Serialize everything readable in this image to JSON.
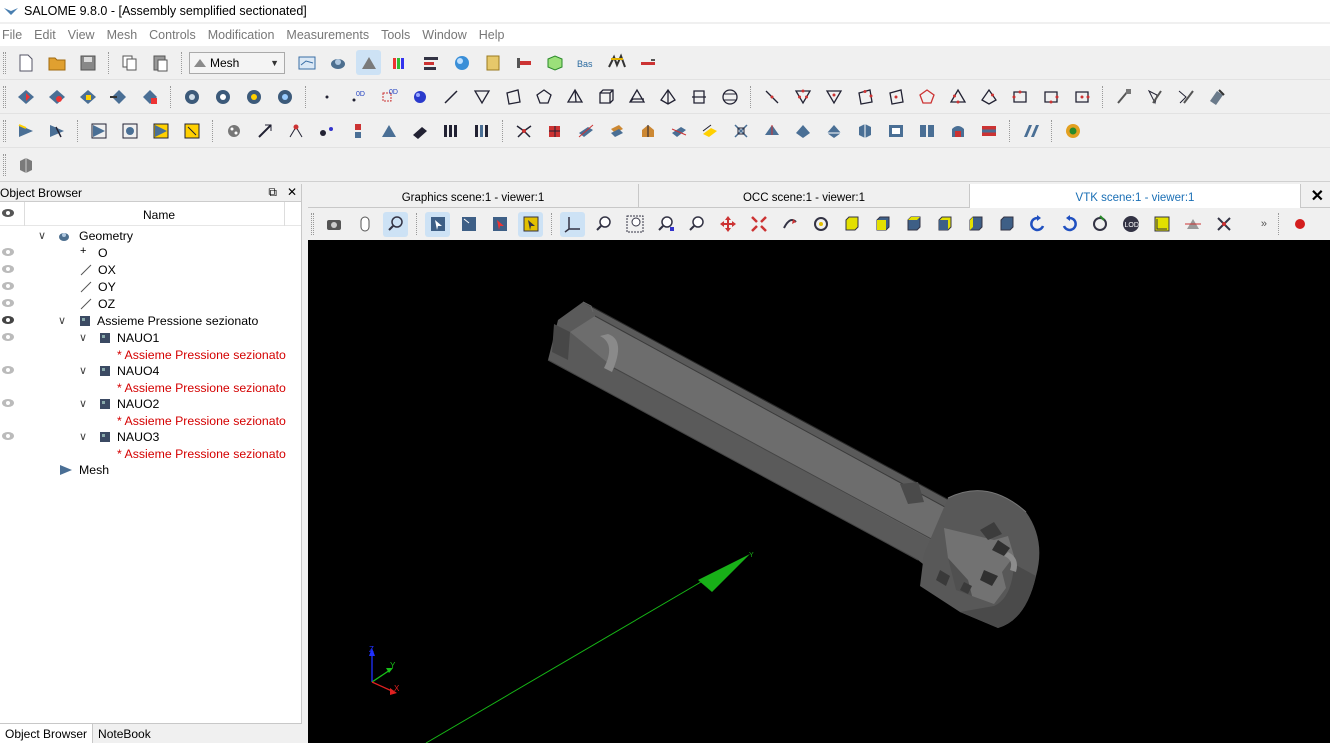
{
  "window": {
    "title": "SALOME  9.8.0 - [Assembly semplified sectionated]"
  },
  "menu": [
    "File",
    "Edit",
    "View",
    "Mesh",
    "Controls",
    "Modification",
    "Measurements",
    "Tools",
    "Window",
    "Help"
  ],
  "toolbar": {
    "module_selector": "Mesh"
  },
  "object_browser": {
    "title": "Object Browser",
    "column_name": "Name",
    "tabs": [
      "Object Browser",
      "NoteBook"
    ],
    "tree": [
      {
        "label": "Geometry",
        "level": 0
      },
      {
        "label": "O",
        "level": 1
      },
      {
        "label": "OX",
        "level": 1
      },
      {
        "label": "OY",
        "level": 1
      },
      {
        "label": "OZ",
        "level": 1
      },
      {
        "label": "Assieme Pressione sezionato",
        "level": 1
      },
      {
        "label": "NAUO1",
        "level": 2
      },
      {
        "label": "* Assieme Pressione sezionato",
        "level": 3
      },
      {
        "label": "NAUO4",
        "level": 2
      },
      {
        "label": "* Assieme Pressione sezionato",
        "level": 3
      },
      {
        "label": "NAUO2",
        "level": 2
      },
      {
        "label": "* Assieme Pressione sezionato",
        "level": 3
      },
      {
        "label": "NAUO3",
        "level": 2
      },
      {
        "label": "* Assieme Pressione sezionato",
        "level": 3
      },
      {
        "label": "Mesh",
        "level": 0
      }
    ]
  },
  "viewer_tabs": [
    "Graphics scene:1 - viewer:1",
    "OCC scene:1 - viewer:1",
    "VTK scene:1 - viewer:1"
  ],
  "viewer_active_tab": "VTK scene:1 - viewer:1",
  "triad": {
    "x": "X",
    "y": "Y",
    "z": "Z"
  },
  "colors": {
    "accent": "#1a6fb5",
    "red_label": "#d40000",
    "viewport_bg": "#000000",
    "model": "#5c5c5c",
    "axis": "#10c010"
  }
}
